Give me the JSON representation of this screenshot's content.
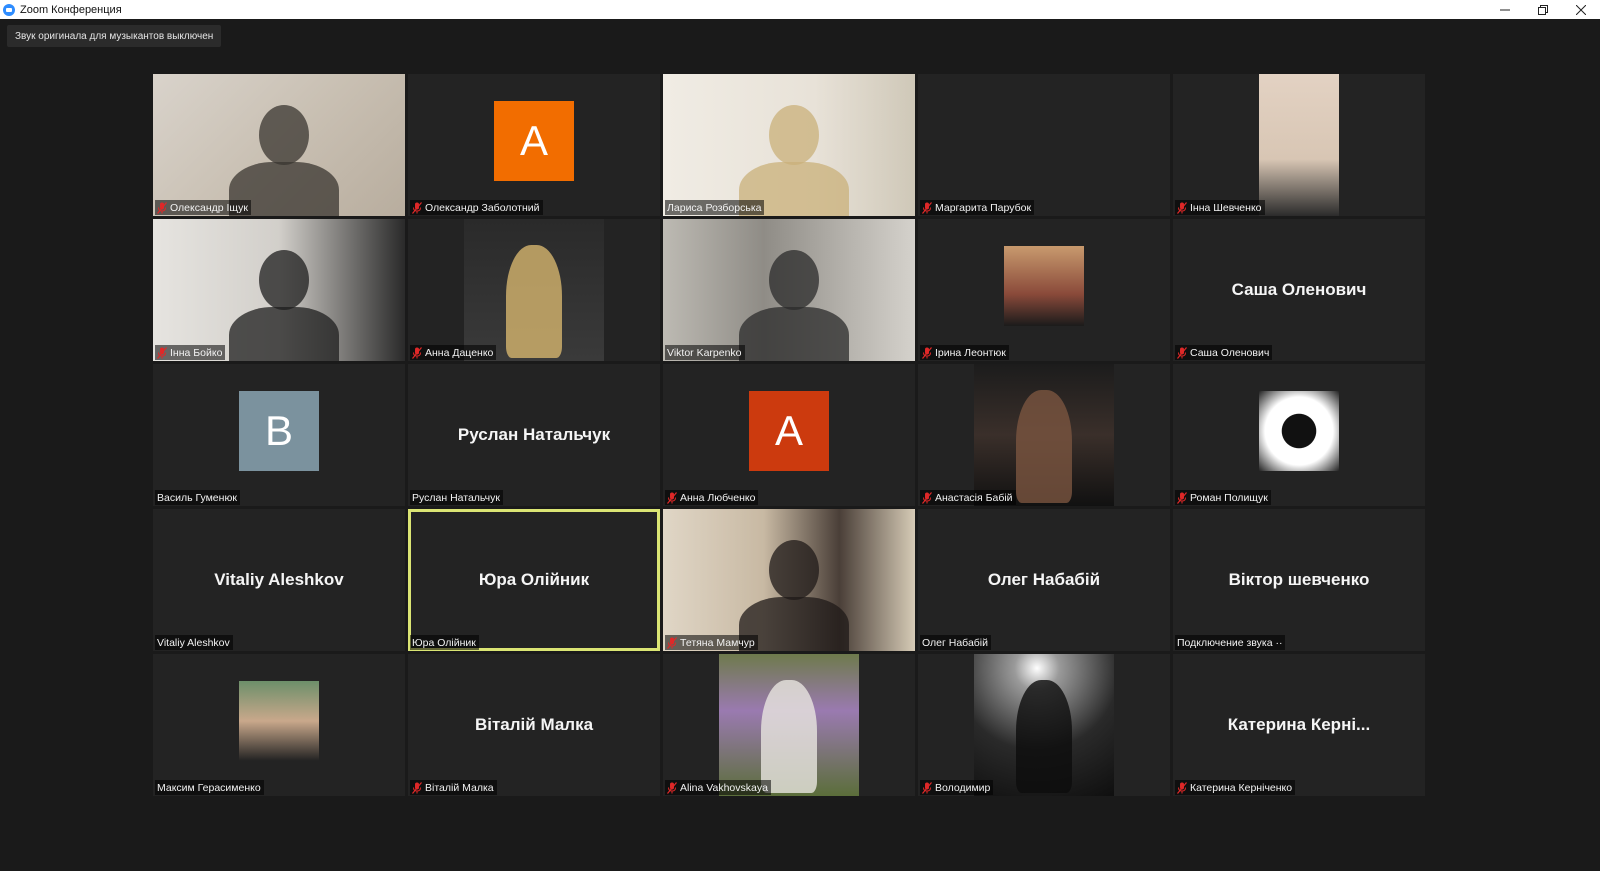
{
  "window": {
    "title": "Zoom Конференция",
    "minimize_icon": "minimize-icon",
    "restore_icon": "restore-icon",
    "close_icon": "close-icon"
  },
  "banner": {
    "text": "Звук оригинала для музыкантов выключен"
  },
  "colors": {
    "background": "#1a1a1a",
    "tile": "#232323",
    "active_speaker_border": "#dbe574",
    "mute_red": "#e02828",
    "avatar_orange": "#f26d00",
    "avatar_grey_blue": "#7b929e",
    "avatar_red_orange": "#cc3a0e"
  },
  "participants": [
    {
      "name": "Олександр Іщук",
      "muted": true,
      "display": "video"
    },
    {
      "name": "Олександр Заболотний",
      "muted": true,
      "display": "avatar",
      "avatar_letter": "A"
    },
    {
      "name": "Лариса Розборська",
      "muted": false,
      "display": "video"
    },
    {
      "name": "Маргарита Парубок",
      "muted": true,
      "display": "blank"
    },
    {
      "name": "Інна Шевченко",
      "muted": true,
      "display": "photo"
    },
    {
      "name": "Інна Бойко",
      "muted": true,
      "display": "video"
    },
    {
      "name": "Анна Даценко",
      "muted": true,
      "display": "photo"
    },
    {
      "name": "Viktor Karpenko",
      "muted": false,
      "display": "video"
    },
    {
      "name": "Ірина Леонтюк",
      "muted": true,
      "display": "small-photo"
    },
    {
      "name": "Саша Оленович",
      "muted": true,
      "display": "name",
      "display_name": "Саша Оленович"
    },
    {
      "name": "Василь Гуменюк",
      "muted": false,
      "display": "avatar",
      "avatar_letter": "B"
    },
    {
      "name": "Руслан Натальчук",
      "muted": false,
      "display": "name",
      "display_name": "Руслан Натальчук"
    },
    {
      "name": "Анна Любченко",
      "muted": true,
      "display": "avatar",
      "avatar_letter": "A"
    },
    {
      "name": "Анастасія  Бабій",
      "muted": true,
      "display": "photo"
    },
    {
      "name": "Роман Полищук",
      "muted": true,
      "display": "small-photo"
    },
    {
      "name": "Vitaliy Aleshkov",
      "muted": false,
      "display": "name",
      "display_name": "Vitaliy Aleshkov"
    },
    {
      "name": "Юра Олійник",
      "muted": false,
      "display": "name",
      "display_name": "Юра Олійник",
      "active_speaker": true
    },
    {
      "name": "Тетяна Мамчур",
      "muted": true,
      "display": "video"
    },
    {
      "name": "Олег Набабій",
      "muted": false,
      "display": "name",
      "display_name": "Олег Набабій"
    },
    {
      "name": "Подключение звука ··",
      "muted": false,
      "display": "name",
      "display_name": "Віктор шевченко"
    },
    {
      "name": "Максим Герасименко",
      "muted": false,
      "display": "small-photo"
    },
    {
      "name": "Віталій Малка",
      "muted": true,
      "display": "name",
      "display_name": "Віталій Малка"
    },
    {
      "name": "Alina Vakhovskaya",
      "muted": true,
      "display": "photo"
    },
    {
      "name": "Володимир",
      "muted": true,
      "display": "photo"
    },
    {
      "name": "Катерина Керніченко",
      "muted": true,
      "display": "name",
      "display_name": "Катерина  Керні..."
    }
  ]
}
